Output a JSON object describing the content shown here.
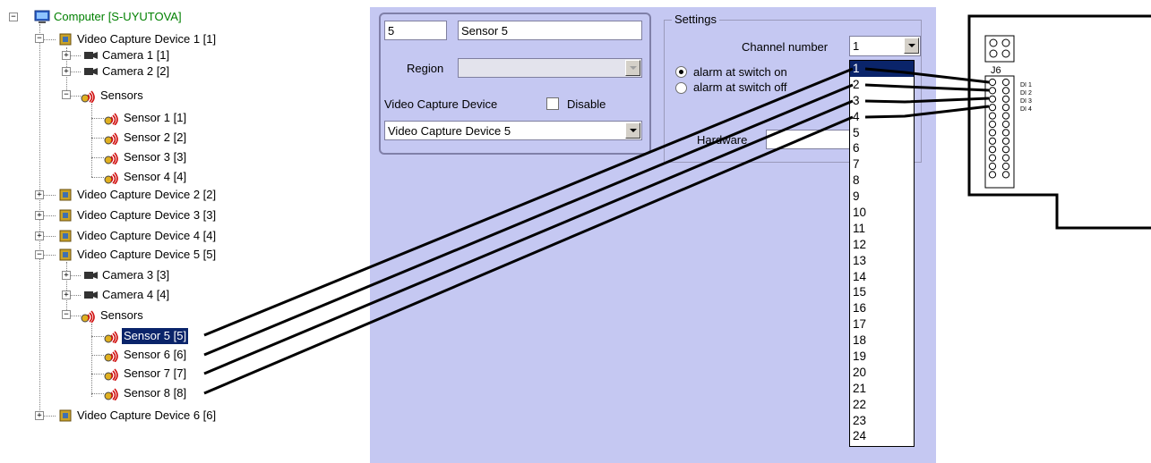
{
  "tree": {
    "root": "Computer [S-UYUTOVA]",
    "device1": "Video Capture Device 1 [1]",
    "camera1": "Camera 1 [1]",
    "camera2": "Camera 2 [2]",
    "sensors1": "Sensors",
    "sensor1": "Sensor 1 [1]",
    "sensor2": "Sensor 2 [2]",
    "sensor3": "Sensor 3 [3]",
    "sensor4": "Sensor 4 [4]",
    "device2": "Video Capture Device 2 [2]",
    "device3": "Video Capture Device 3 [3]",
    "device4": "Video Capture Device 4 [4]",
    "device5": "Video Capture Device 5 [5]",
    "camera3": "Camera 3 [3]",
    "camera4": "Camera 4 [4]",
    "sensors5": "Sensors",
    "sensor5": "Sensor 5 [5]",
    "sensor6": "Sensor 6 [6]",
    "sensor7": "Sensor 7 [7]",
    "sensor8": "Sensor 8 [8]",
    "device6": "Video Capture Device 6 [6]"
  },
  "props": {
    "id_value": "5",
    "name_value": "Sensor 5",
    "region_label": "Region",
    "region_value": "",
    "vcd_label": "Video Capture Device",
    "disable_label": "Disable",
    "vcd_value": "Video Capture Device 5"
  },
  "settings": {
    "title": "Settings",
    "channel_label": "Channel number",
    "channel_value": "1",
    "alarm_on_label": "alarm at switch on",
    "alarm_off_label": "alarm at switch off",
    "hardware_label": "Hardware",
    "channel_options": [
      "1",
      "2",
      "3",
      "4",
      "5",
      "6",
      "7",
      "8",
      "9",
      "10",
      "11",
      "12",
      "13",
      "14",
      "15",
      "16",
      "17",
      "18",
      "19",
      "20",
      "21",
      "22",
      "23",
      "24"
    ]
  },
  "board": {
    "connector": "J6",
    "pins": [
      "DI 1",
      "DI 2",
      "DI 3",
      "DI 4"
    ]
  },
  "colors": {
    "panel_bg": "#c5c8f2",
    "selection": "#0a246a",
    "tree_root_text": "#008000"
  }
}
